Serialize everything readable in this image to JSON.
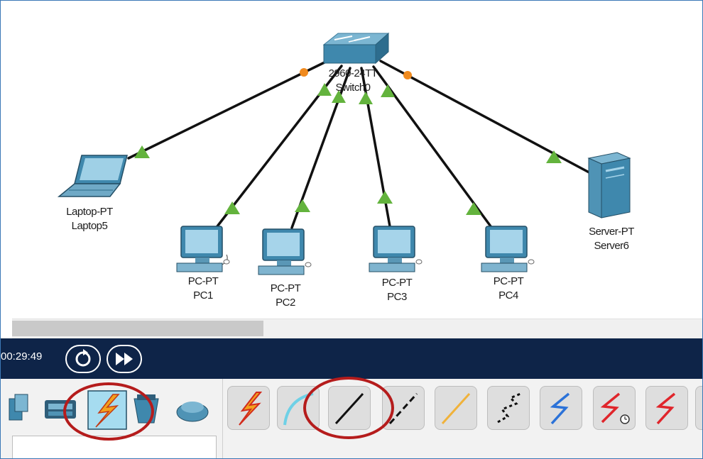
{
  "topology": {
    "switch": {
      "model": "2960-24TT",
      "name": "Switch0"
    },
    "devices": [
      {
        "model": "Laptop-PT",
        "name": "Laptop5"
      },
      {
        "model": "PC-PT",
        "name": "PC1"
      },
      {
        "model": "PC-PT",
        "name": "PC2"
      },
      {
        "model": "PC-PT",
        "name": "PC3"
      },
      {
        "model": "PC-PT",
        "name": "PC4"
      },
      {
        "model": "Server-PT",
        "name": "Server6"
      }
    ],
    "link_colors": {
      "up": "#63b33d",
      "pending": "#f08a1e",
      "cable": "#111111"
    }
  },
  "timebar": {
    "clock": "00:29:49",
    "buttons": [
      "reset-time",
      "fast-forward-time"
    ]
  },
  "device_categories": [
    "end-devices",
    "components",
    "connections",
    "miscellaneous",
    "multiuser"
  ],
  "connection_types": [
    "automatic",
    "console",
    "copper-straight-through",
    "copper-cross-over",
    "fiber",
    "phone",
    "coaxial",
    "serial-dce",
    "serial-dte"
  ],
  "highlight_color": "#b51c1c"
}
